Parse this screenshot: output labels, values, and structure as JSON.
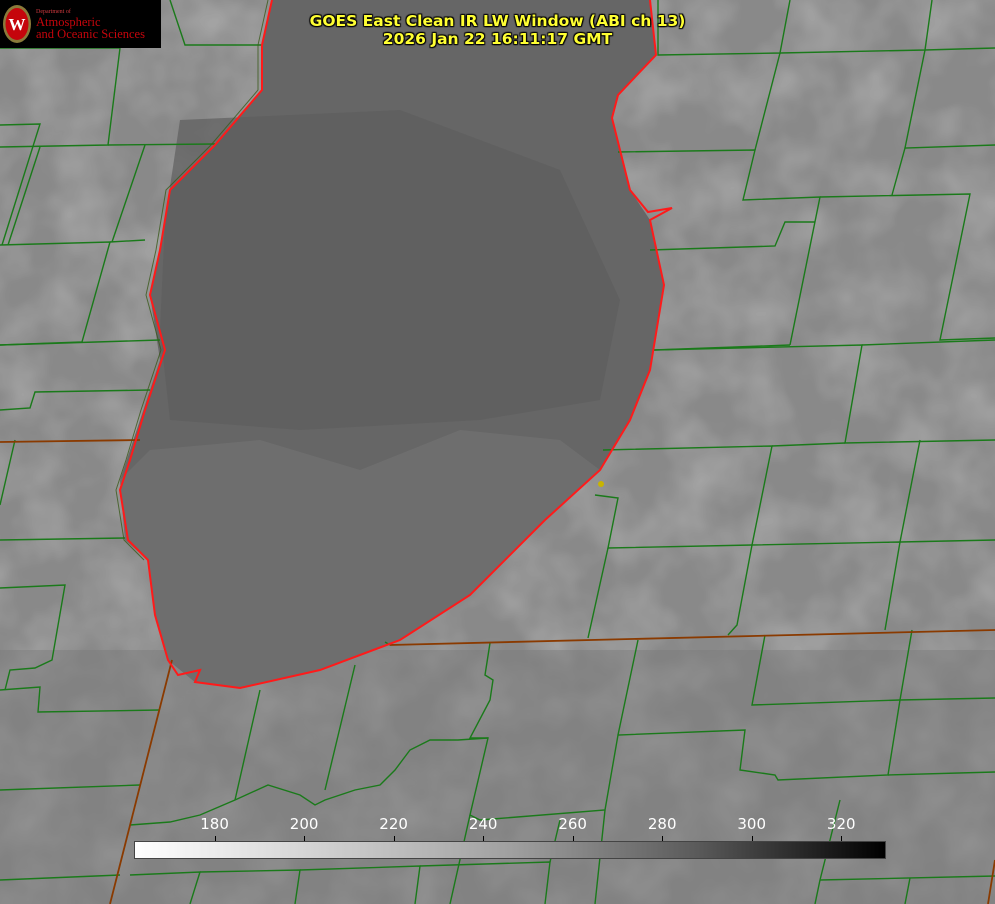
{
  "title": {
    "line1": "GOES East Clean IR LW Window (ABI ch 13)",
    "line2": "2026 Jan 22 16:11:17 GMT"
  },
  "logo": {
    "dept": "Department of",
    "line1": "Atmospheric",
    "line2": "and Oceanic Sciences",
    "brand_color": "#c5050c"
  },
  "colorbar": {
    "ticks": [
      "180",
      "200",
      "220",
      "240",
      "260",
      "280",
      "300",
      "320"
    ],
    "range": [
      162,
      330
    ],
    "colormap": "white-to-black"
  },
  "colors": {
    "county_lines": "#1a7a1a",
    "coastline": "#ff2020",
    "state_line": "#8a3a00",
    "marker": "#c8b400",
    "lake_gray": "#666666",
    "land_gray": "#8a8a8a"
  }
}
